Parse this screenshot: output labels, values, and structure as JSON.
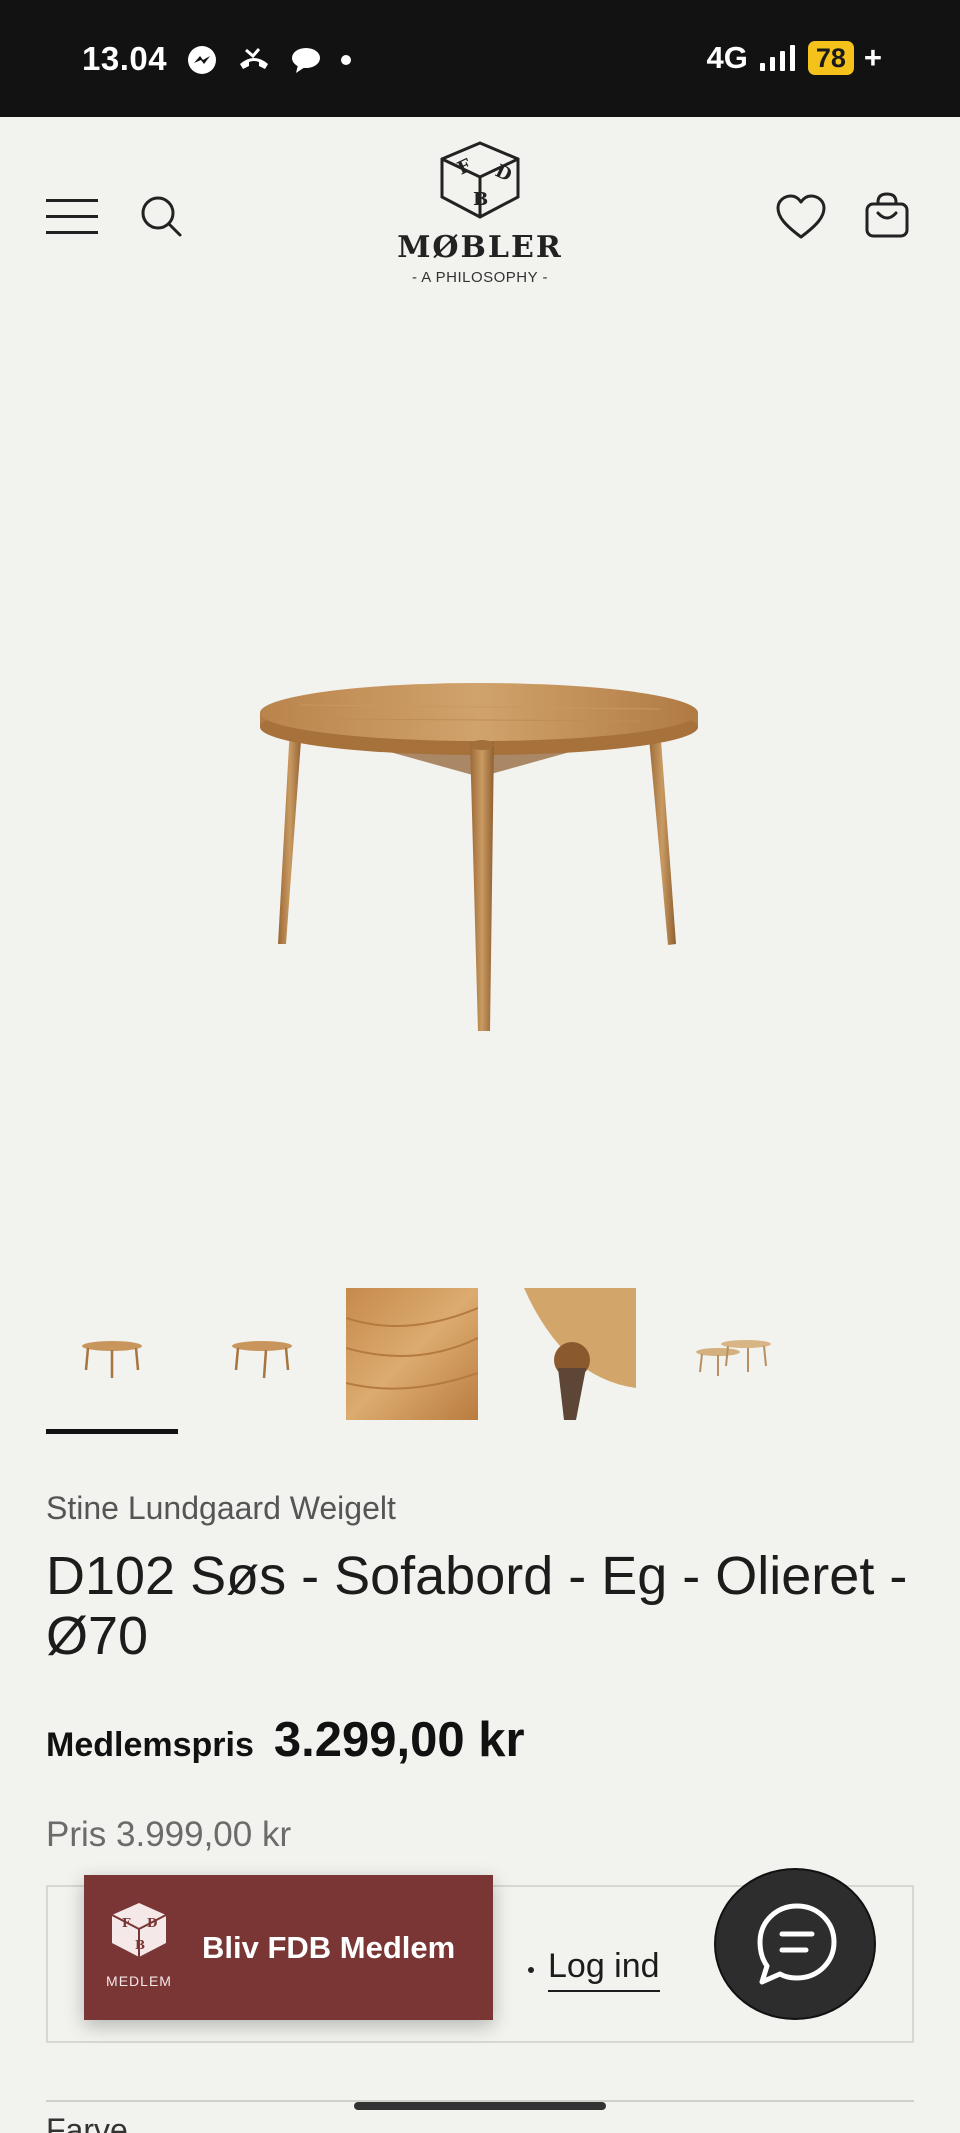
{
  "status_bar": {
    "time": "13.04",
    "network": "4G",
    "battery": "78",
    "battery_suffix": "+",
    "icons": [
      "messenger-icon",
      "missed-call-icon",
      "chat-bubble-icon",
      "dot-icon",
      "signal-icon"
    ]
  },
  "header": {
    "logo_title": "MØBLER",
    "logo_subtitle": "- A PHILOSOPHY -",
    "logo_mark": "FDB",
    "icons": [
      "menu-icon",
      "search-icon",
      "heart-icon",
      "shopping-bag-icon"
    ]
  },
  "gallery": {
    "thumbnail_count": 5,
    "active_index": 0
  },
  "product": {
    "designer": "Stine Lundgaard Weigelt",
    "title": "D102 Søs - Sofabord - Eg - Olieret - Ø70",
    "member_price_label": "Medlemspris",
    "member_price": "3.299,00 kr",
    "regular_price": "Pris 3.999,00 kr"
  },
  "login": {
    "link_text": "Log ind"
  },
  "fdb_popup": {
    "label": "Bliv FDB Medlem",
    "logo_caption": "MEDLEM"
  },
  "options": {
    "color_label": "Farve"
  },
  "colors": {
    "accent": "#7a3535",
    "status_bar": "#121212",
    "background": "#f2f2ee",
    "battery": "#f4c21b"
  }
}
